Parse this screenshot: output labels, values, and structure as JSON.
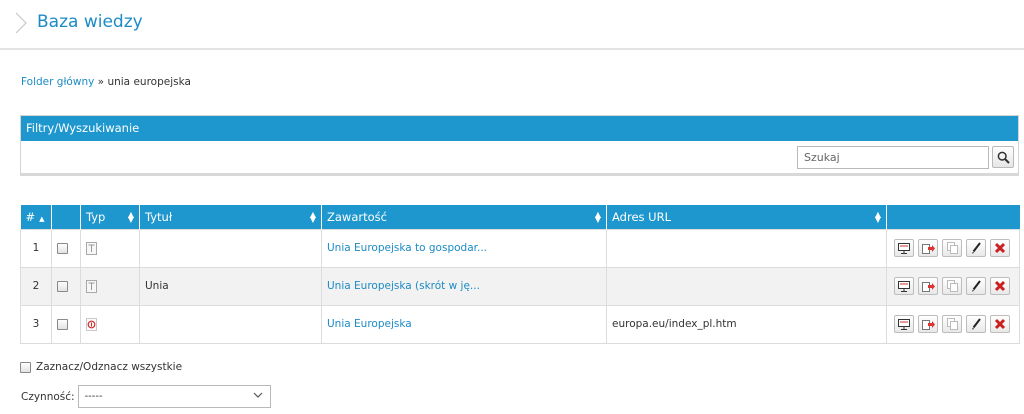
{
  "header": {
    "title": "Baza wiedzy"
  },
  "breadcrumb": {
    "root": "Folder główny",
    "separator": "»",
    "current": "unia europejska"
  },
  "filters": {
    "title": "Filtry/Wyszukiwanie",
    "search_placeholder": "Szukaj"
  },
  "table": {
    "columns": [
      "#",
      "Typ",
      "Tytuł",
      "Zawartość",
      "Adres URL"
    ],
    "rows": [
      {
        "num": "1",
        "type_icon": "text-document-icon",
        "title": "",
        "content": "Unia Europejska to gospodar...",
        "url": ""
      },
      {
        "num": "2",
        "type_icon": "text-document-icon",
        "title": "Unia",
        "content": "Unia Europejska (skrót w ję...",
        "url": ""
      },
      {
        "num": "3",
        "type_icon": "link-icon",
        "title": "",
        "content": "Unia Europejska",
        "url": "europa.eu/index_pl.htm"
      }
    ],
    "row_actions": [
      "preview-icon",
      "move-icon",
      "copy-icon",
      "edit-icon",
      "delete-icon"
    ]
  },
  "footer": {
    "select_all_label": "Zaznacz/Odznacz wszystkie",
    "action_label": "Czynność:",
    "action_value": "-----"
  },
  "colors": {
    "accent": "#1e97cf",
    "link": "#1b8bc5",
    "delete": "#cc1f1f"
  }
}
